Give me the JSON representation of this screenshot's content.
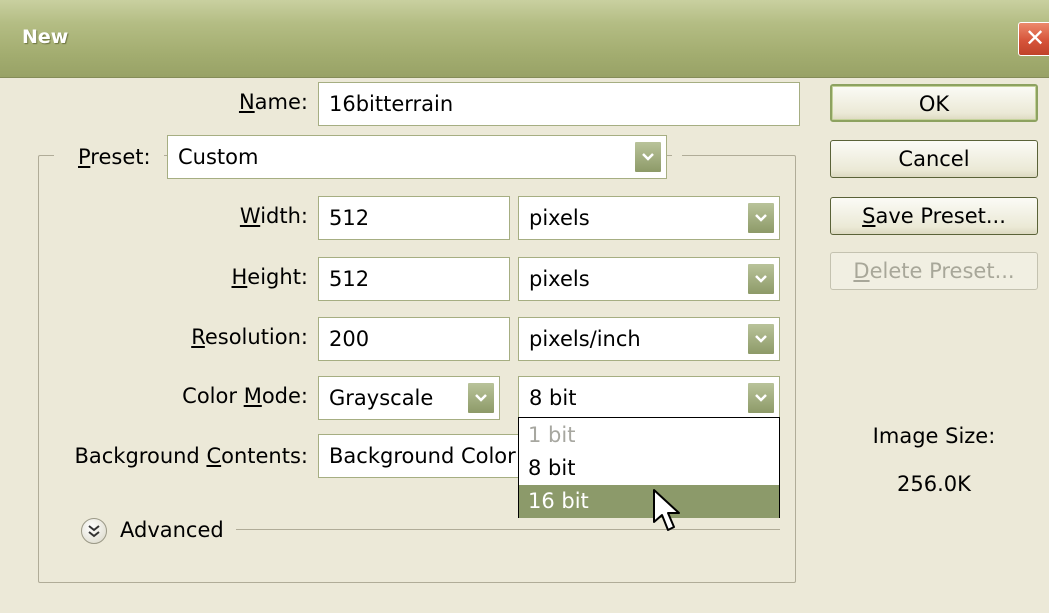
{
  "window": {
    "title": "New",
    "close_icon": "close-icon"
  },
  "name": {
    "label": "Name:",
    "value": "16bitterrain"
  },
  "preset": {
    "label": "Preset:",
    "value": "Custom"
  },
  "width": {
    "label": "Width:",
    "value": "512",
    "unit": "pixels"
  },
  "height": {
    "label": "Height:",
    "value": "512",
    "unit": "pixels"
  },
  "resolution": {
    "label": "Resolution:",
    "value": "200",
    "unit": "pixels/inch"
  },
  "color_mode": {
    "label": "Color Mode:",
    "value": "Grayscale",
    "bit_depth": "8 bit",
    "bit_options": [
      {
        "label": "1 bit",
        "state": "disabled"
      },
      {
        "label": "8 bit",
        "state": "normal"
      },
      {
        "label": "16 bit",
        "state": "hovered"
      }
    ]
  },
  "background_contents": {
    "label": "Background Contents:",
    "value": "Background Color"
  },
  "advanced": {
    "label": "Advanced"
  },
  "buttons": {
    "ok": "OK",
    "cancel": "Cancel",
    "save_preset": "Save Preset...",
    "delete_preset": "Delete Preset..."
  },
  "image_size": {
    "label": "Image Size:",
    "value": "256.0K"
  },
  "colors": {
    "title_bar": "#a3ad70",
    "dialog_bg": "#ece9d8",
    "highlight": "#8c9a6a",
    "close": "#d6543a"
  }
}
